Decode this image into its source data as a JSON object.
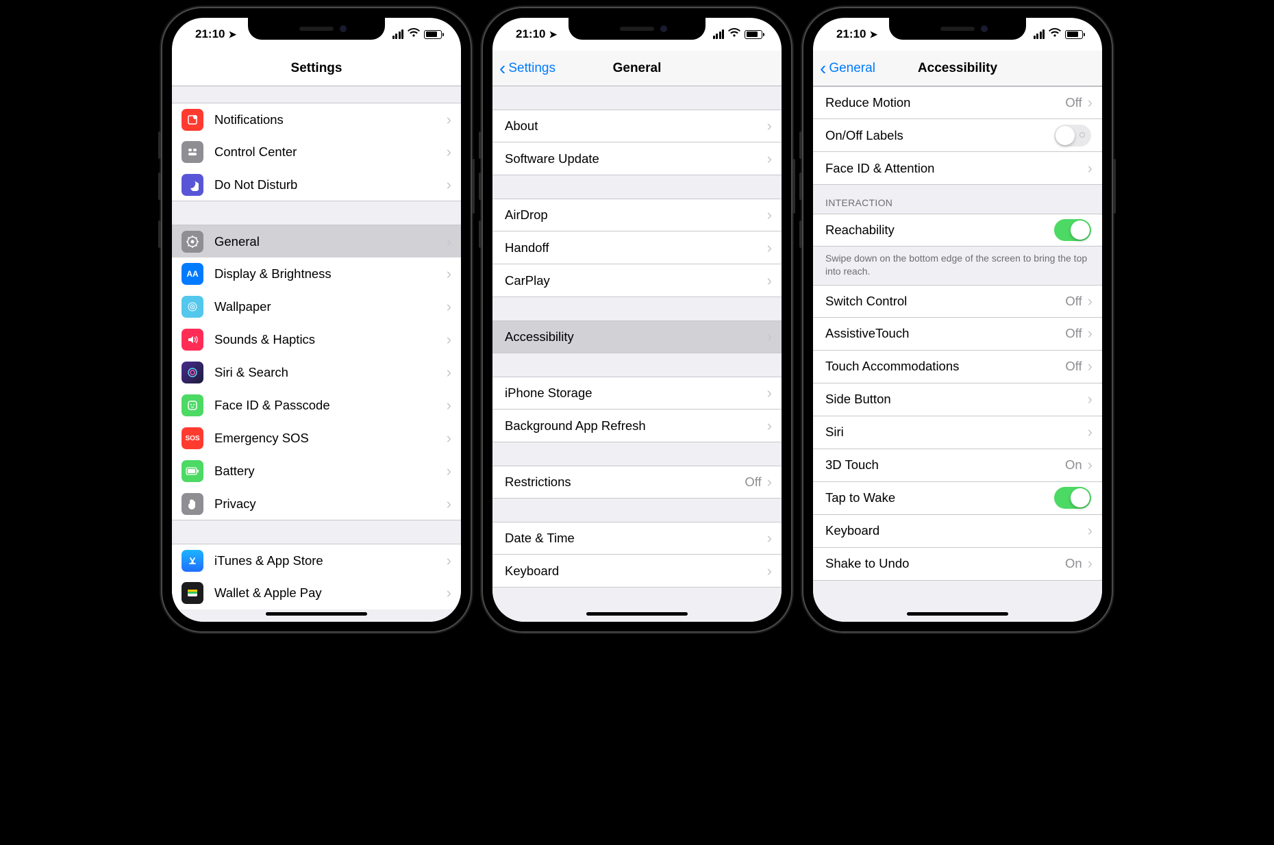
{
  "status": {
    "time": "21:10"
  },
  "phone1": {
    "title": "Settings",
    "rows": [
      {
        "label": "Notifications",
        "icon": "#ff3b30",
        "glyph": "◻︎"
      },
      {
        "label": "Control Center",
        "icon": "#8e8e93",
        "glyph": "⊟"
      },
      {
        "label": "Do Not Disturb",
        "icon": "#5856d6",
        "glyph": "☾"
      },
      {
        "label": "General",
        "icon": "#8e8e93",
        "glyph": "⚙"
      },
      {
        "label": "Display & Brightness",
        "icon": "#007aff",
        "glyph": "AA"
      },
      {
        "label": "Wallpaper",
        "icon": "#54c7ec",
        "glyph": "✿"
      },
      {
        "label": "Sounds & Haptics",
        "icon": "#ff2d55",
        "glyph": "🔊"
      },
      {
        "label": "Siri & Search",
        "icon": "#1c1c1e",
        "glyph": "◉"
      },
      {
        "label": "Face ID & Passcode",
        "icon": "#4cd964",
        "glyph": "☻"
      },
      {
        "label": "Emergency SOS",
        "icon": "#ff3b30",
        "glyph": "SOS"
      },
      {
        "label": "Battery",
        "icon": "#4cd964",
        "glyph": "▮"
      },
      {
        "label": "Privacy",
        "icon": "#8e8e93",
        "glyph": "✋"
      },
      {
        "label": "iTunes & App Store",
        "icon": "#1e90ff",
        "glyph": "A"
      },
      {
        "label": "Wallet & Apple Pay",
        "icon": "#1c1c1e",
        "glyph": "▭"
      }
    ]
  },
  "phone2": {
    "back": "Settings",
    "title": "General",
    "rows": {
      "g1": [
        "About",
        "Software Update"
      ],
      "g2": [
        "AirDrop",
        "Handoff",
        "CarPlay"
      ],
      "g3": [
        "Accessibility"
      ],
      "g4": [
        "iPhone Storage",
        "Background App Refresh"
      ],
      "g5": [
        {
          "label": "Restrictions",
          "value": "Off"
        }
      ],
      "g6": [
        "Date & Time",
        "Keyboard"
      ]
    }
  },
  "phone3": {
    "back": "General",
    "title": "Accessibility",
    "rows": {
      "top": [
        {
          "label": "Reduce Motion",
          "value": "Off"
        },
        {
          "label": "On/Off Labels",
          "toggle": "off"
        },
        {
          "label": "Face ID & Attention"
        }
      ],
      "interaction_header": "INTERACTION",
      "reach": {
        "label": "Reachability",
        "toggle": "on"
      },
      "reach_footer": "Swipe down on the bottom edge of the screen to bring the top into reach.",
      "list": [
        {
          "label": "Switch Control",
          "value": "Off"
        },
        {
          "label": "AssistiveTouch",
          "value": "Off"
        },
        {
          "label": "Touch Accommodations",
          "value": "Off"
        },
        {
          "label": "Side Button"
        },
        {
          "label": "Siri"
        },
        {
          "label": "3D Touch",
          "value": "On"
        },
        {
          "label": "Tap to Wake",
          "toggle": "on"
        },
        {
          "label": "Keyboard"
        },
        {
          "label": "Shake to Undo",
          "value": "On"
        }
      ]
    }
  }
}
